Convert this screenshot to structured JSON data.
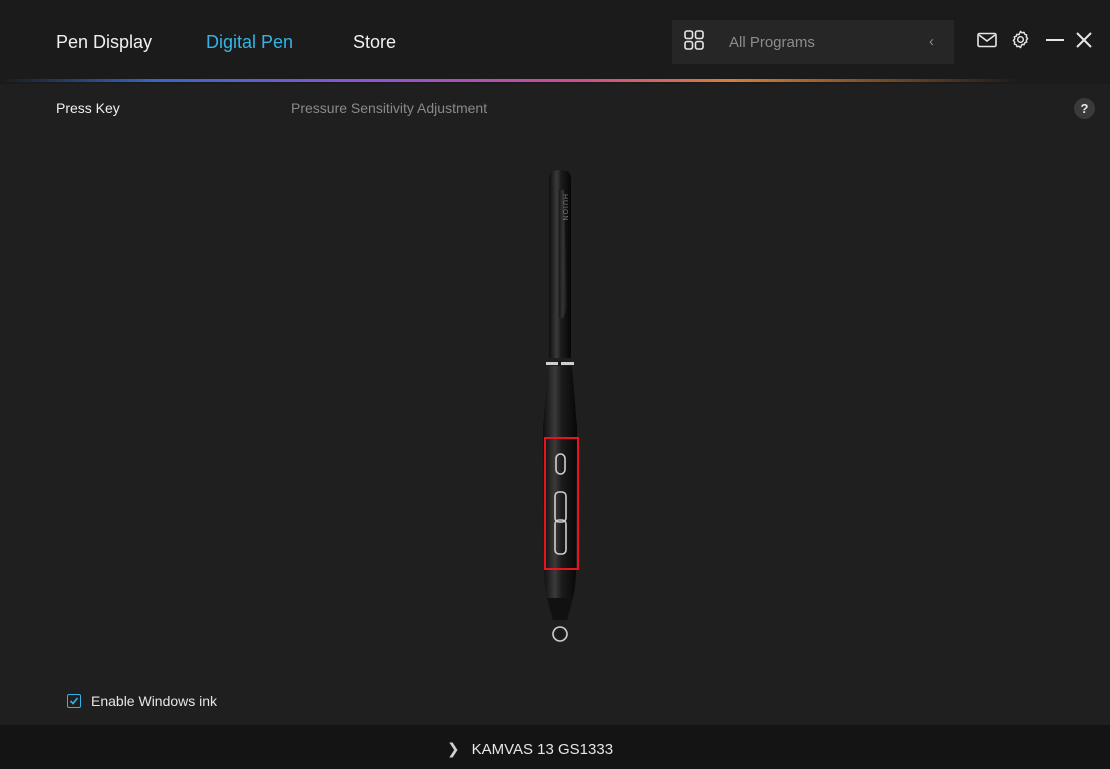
{
  "top_nav": {
    "tabs": [
      {
        "label": "Pen Display",
        "active": false
      },
      {
        "label": "Digital Pen",
        "active": true
      },
      {
        "label": "Store",
        "active": false
      }
    ],
    "programs": {
      "label": "All Programs",
      "icon": "grid-icon",
      "collapse_icon": "chevron-left-icon"
    },
    "window_icons": [
      "mail-icon",
      "gear-icon",
      "minimize-icon",
      "close-icon"
    ]
  },
  "sub_tabs": {
    "items": [
      {
        "label": "Press Key",
        "active": true
      },
      {
        "label": "Pressure Sensitivity Adjustment",
        "active": false
      }
    ],
    "help_label": "?"
  },
  "pen": {
    "brand_text": "HUION",
    "highlight_color": "#e8141b"
  },
  "windows_ink": {
    "label": "Enable Windows ink",
    "checked": true
  },
  "footer": {
    "device_name": "KAMVAS 13 GS1333"
  },
  "colors": {
    "accent": "#34b4e6",
    "background": "#1f1f1f",
    "header": "#1b1b1b",
    "footer": "#141414"
  }
}
